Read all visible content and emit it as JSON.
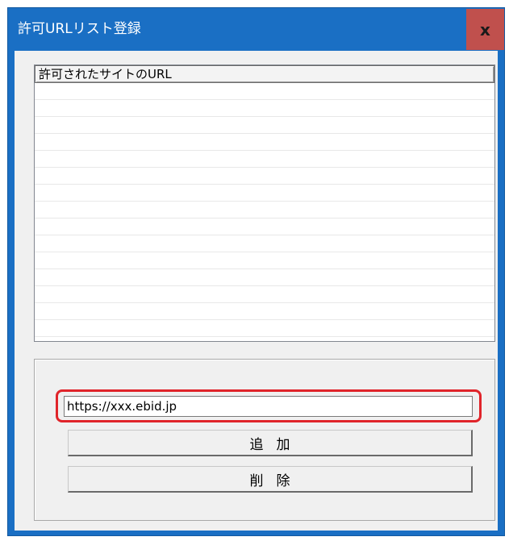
{
  "window": {
    "title": "許可URLリスト登録",
    "close_label": "x"
  },
  "list": {
    "column_header": "許可されたサイトのURL",
    "rows": []
  },
  "form": {
    "url_value": "https://xxx.ebid.jp",
    "add_label": "追加",
    "delete_label": "削除"
  },
  "colors": {
    "titlebar": "#1a6fc4",
    "close_button": "#c0504d",
    "highlight_border": "#e0242a",
    "client_bg": "#f0f0f0"
  }
}
